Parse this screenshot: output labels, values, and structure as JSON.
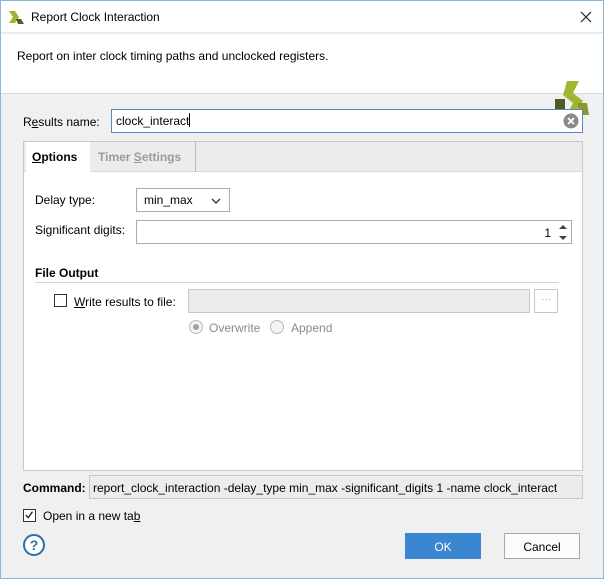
{
  "window": {
    "title": "Report Clock Interaction",
    "close_icon": "close-icon",
    "app_icon": "vivado-logo-icon"
  },
  "header": {
    "description": "Report on inter clock timing paths and unclocked registers."
  },
  "results": {
    "label_pre": "R",
    "label_u": "e",
    "label_post": "sults name:",
    "value": "clock_interact"
  },
  "tabs": [
    {
      "label_u": "O",
      "label_post": "ptions",
      "active": true
    },
    {
      "label_pre": "Timer ",
      "label_u": "S",
      "label_post": "ettings",
      "active": false
    }
  ],
  "options": {
    "delay_type": {
      "label": "Delay type:",
      "value": "min_max"
    },
    "significant_digits": {
      "label": "Significant digits:",
      "value": "1"
    },
    "file_output": {
      "title": "File Output",
      "write_label_u": "W",
      "write_label_post": "rite results to file:",
      "write_checked": false,
      "path_value": "",
      "browse_label": "···",
      "overwrite_label": "Overwrite",
      "append_label": "Append",
      "mode": "Overwrite"
    }
  },
  "command": {
    "label": "Command:",
    "value": "report_clock_interaction -delay_type min_max -significant_digits 1 -name clock_interact"
  },
  "open_new_tab": {
    "label_pre": "Open in a new ta",
    "label_u": "b",
    "checked": true
  },
  "buttons": {
    "help": "?",
    "ok": "OK",
    "cancel": "Cancel"
  },
  "colors": {
    "accent": "#3b86d1",
    "focus_border": "#5a86c8",
    "logo_green": "#a0b532",
    "logo_dark": "#555b1e"
  }
}
